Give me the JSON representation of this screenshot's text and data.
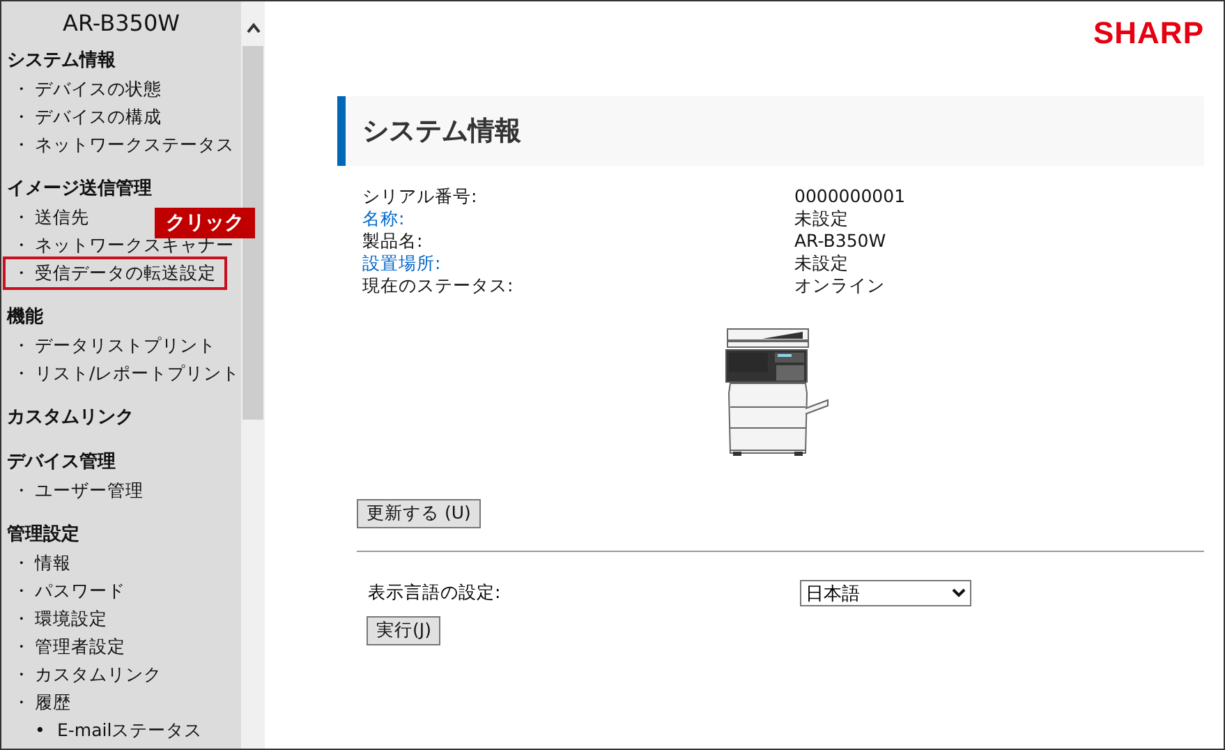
{
  "sidebar": {
    "model": "AR-B350W",
    "sections": [
      {
        "title": "システム情報",
        "items": [
          {
            "bullet": "・",
            "label": "デバイスの状態",
            "highlighted": false
          },
          {
            "bullet": "・",
            "label": "デバイスの構成",
            "highlighted": false
          },
          {
            "bullet": "・",
            "label": "ネットワークステータス",
            "highlighted": false
          }
        ]
      },
      {
        "title": "イメージ送信管理",
        "items": [
          {
            "bullet": "・",
            "label": "送信先",
            "highlighted": false
          },
          {
            "bullet": "・",
            "label": "ネットワークスキャナー",
            "highlighted": false
          },
          {
            "bullet": "・",
            "label": "受信データの転送設定",
            "highlighted": true
          }
        ]
      },
      {
        "title": "機能",
        "items": [
          {
            "bullet": "・",
            "label": "データリストプリント",
            "highlighted": false
          },
          {
            "bullet": "・",
            "label": "リスト/レポートプリント",
            "highlighted": false
          }
        ]
      },
      {
        "title": "カスタムリンク"
      },
      {
        "title": "デバイス管理",
        "items": [
          {
            "bullet": "・",
            "label": "ユーザー管理",
            "highlighted": false
          }
        ]
      },
      {
        "title": "管理設定",
        "items": [
          {
            "bullet": "・",
            "label": "情報",
            "highlighted": false
          },
          {
            "bullet": "・",
            "label": "パスワード",
            "highlighted": false
          },
          {
            "bullet": "・",
            "label": "環境設定",
            "highlighted": false
          },
          {
            "bullet": "・",
            "label": "管理者設定",
            "highlighted": false
          },
          {
            "bullet": "・",
            "label": "カスタムリンク",
            "highlighted": false
          },
          {
            "bullet": "・",
            "label": "履歴",
            "highlighted": false,
            "children": [
              {
                "bullet": "•",
                "label": "E-mailステータス",
                "highlighted": false
              }
            ]
          }
        ]
      }
    ]
  },
  "callout": {
    "text": "クリック"
  },
  "brand": {
    "logo": "SHARP"
  },
  "page_title": "システム情報",
  "info": [
    {
      "label": "シリアル番号:",
      "value": "0000000001",
      "link": false
    },
    {
      "label": "名称:",
      "value": "未設定",
      "link": true
    },
    {
      "label": "製品名:",
      "value": "AR-B350W",
      "link": false
    },
    {
      "label": "設置場所:",
      "value": "未設定",
      "link": true
    },
    {
      "label": "現在のステータス:",
      "value": "オンライン",
      "link": false
    }
  ],
  "refresh_button": "更新する (U)",
  "language": {
    "label": "表示言語の設定:",
    "value": "日本語"
  },
  "execute_button": "実行(J)"
}
